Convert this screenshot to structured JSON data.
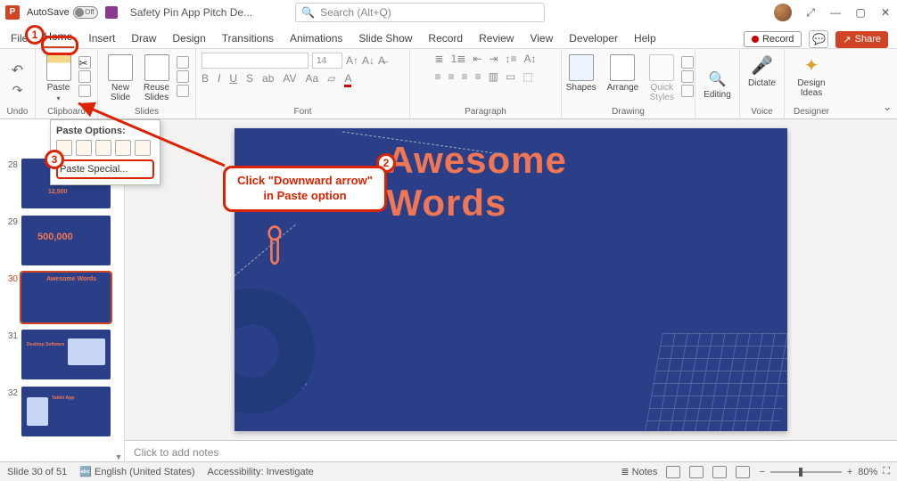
{
  "titlebar": {
    "autosave_label": "AutoSave",
    "autosave_state": "Off",
    "doc_title": "Safety Pin App Pitch De...",
    "search_placeholder": "Search (Alt+Q)"
  },
  "tabs": {
    "items": [
      "File",
      "Home",
      "Insert",
      "Draw",
      "Design",
      "Transitions",
      "Animations",
      "Slide Show",
      "Record",
      "Review",
      "View",
      "Developer",
      "Help"
    ],
    "active": "Home",
    "record_label": "Record",
    "share_label": "Share"
  },
  "ribbon": {
    "undo_label": "Undo",
    "paste_label": "Paste",
    "clipboard_label": "Clipboard",
    "new_slide_label": "New\nSlide",
    "reuse_slides_label": "Reuse\nSlides",
    "slides_label": "Slides",
    "font_size_value": "14",
    "font_label": "Font",
    "paragraph_label": "Paragraph",
    "shapes_label": "Shapes",
    "arrange_label": "Arrange",
    "quick_styles_label": "Quick\nStyles",
    "drawing_label": "Drawing",
    "editing_label": "Editing",
    "dictate_label": "Dictate",
    "voice_label": "Voice",
    "design_ideas_label": "Design\nIdeas",
    "designer_label": "Designer"
  },
  "paste_popup": {
    "header": "Paste Options:",
    "special": "Paste Special..."
  },
  "thumbs": [
    {
      "num": "28",
      "title": "12,500"
    },
    {
      "num": "29",
      "title": "500,000"
    },
    {
      "num": "30",
      "title": "Awesome Words"
    },
    {
      "num": "31",
      "title": "Desktop Software"
    },
    {
      "num": "32",
      "title": "Tablet App"
    }
  ],
  "slide": {
    "title": "Awesome Words"
  },
  "notes": {
    "placeholder": "Click to add notes"
  },
  "status": {
    "slide_count": "Slide 30 of 51",
    "language": "English (United States)",
    "accessibility": "Accessibility: Investigate",
    "notes_btn": "Notes",
    "zoom_pct": "80%"
  },
  "annotations": {
    "c1": "1",
    "c2": "2",
    "c3": "3",
    "callout": "Click \"Downward arrow\" in Paste option"
  }
}
